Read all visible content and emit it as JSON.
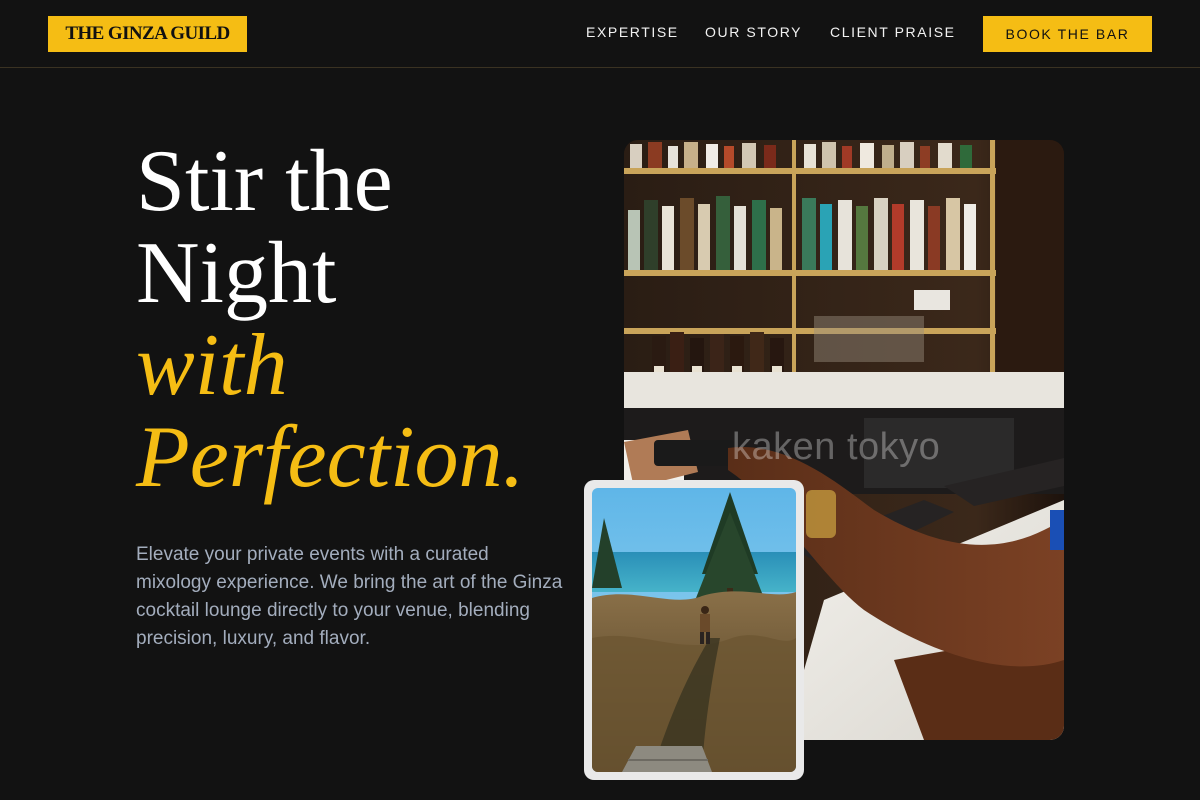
{
  "brand": {
    "logo_text": "THE GINZA GUILD"
  },
  "nav": {
    "links": [
      {
        "label": "EXPERTISE"
      },
      {
        "label": "OUR STORY"
      },
      {
        "label": "CLIENT PRAISE"
      }
    ],
    "cta_label": "BOOK THE BAR"
  },
  "hero": {
    "headline_line1": "Stir the",
    "headline_line2": "Night",
    "headline_line3": "with",
    "headline_line4": "Perfection.",
    "description": "Elevate your private events with a curated mixology experience. We bring the art of the Ginza cocktail lounge directly to your venue, blending precision, luxury, and flavor.",
    "photo_watermark": "kaken tokyo"
  },
  "colors": {
    "background": "#121212",
    "accent": "#f5bd14",
    "body_text": "#a3adbd"
  }
}
